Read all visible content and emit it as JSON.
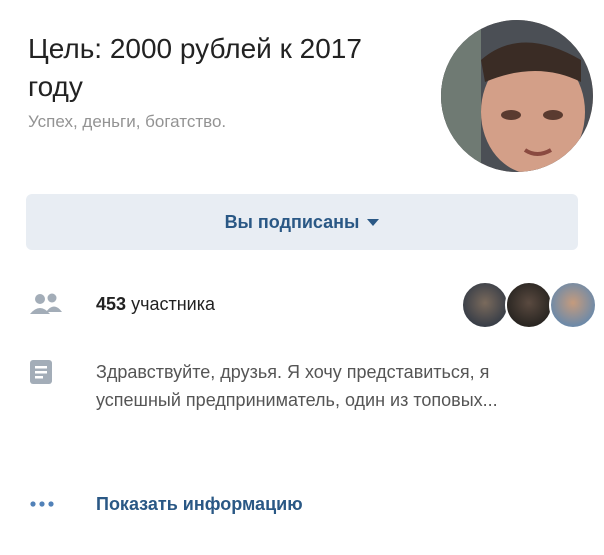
{
  "group": {
    "title": "Цель: 2000 рублей к 2017 году",
    "status": "Успех, деньги, богатство."
  },
  "subscribe": {
    "label": "Вы подписаны"
  },
  "members": {
    "count": "453",
    "label": "участника"
  },
  "about": {
    "text": "Здравствуйте, друзья. Я хочу представиться, я успешный предприниматель, один из топовых..."
  },
  "more": {
    "label": "Показать информацию"
  },
  "icons": {
    "members": "people-icon",
    "about": "document-icon",
    "more": "more-dots-icon",
    "caret": "caret-down-icon"
  },
  "colors": {
    "link": "#2a5885",
    "button_bg": "#e8edf3",
    "secondary_text": "#939393",
    "icon": "#a3adb8"
  }
}
